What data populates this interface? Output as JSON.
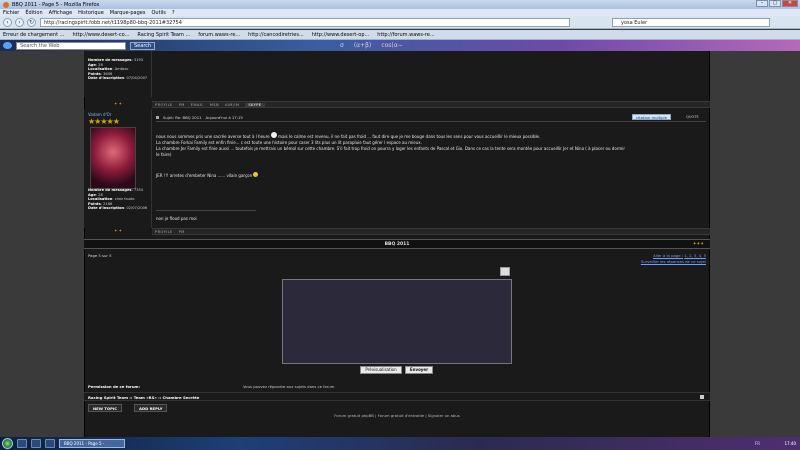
{
  "window": {
    "title": "BBQ 2011 - Page 5 - Mozilla Firefox"
  },
  "menu": [
    "Fichier",
    "Édition",
    "Affichage",
    "Historique",
    "Marque-pages",
    "Outils",
    "?"
  ],
  "urlbar": {
    "value": "http://racingspirit.fobb.net/t1198p80-bbq-2011#32754"
  },
  "browser_search": {
    "placeholder": "yosa Euler"
  },
  "bookmarks": [
    "Erreur de chargement ...",
    "http://www.desert-co...",
    "Racing Spirit Team ...",
    "forum.waws-re...",
    "http://cancodiretries...",
    "http://www.desert-op...",
    "http://forum.waws-re..."
  ],
  "addon_toolbar": {
    "search_placeholder": "Search the Web",
    "search_button": "Search"
  },
  "post1": {
    "stats": [
      [
        "Nombre de messages",
        "3193"
      ],
      [
        "Age",
        "26"
      ],
      [
        "Localisation",
        "Amtbac"
      ],
      [
        "Points",
        "3606"
      ],
      [
        "Date d'inscription",
        "07/04/2007"
      ]
    ]
  },
  "postbar1": [
    "PROFILE",
    "PM",
    "EMAIL",
    "MSN",
    "AIM/IM",
    "SKYPE"
  ],
  "post2": {
    "username": "Vadam d'Or",
    "subject": "Sujet: Re: BBQ 2011",
    "date": "Aujourd'hui à 17:15",
    "quote_multi": "citation multiple",
    "quote": "QUOTE",
    "stats": [
      [
        "Nombre de messages",
        "7354"
      ],
      [
        "Age",
        "28"
      ],
      [
        "Localisation",
        "chez foudo"
      ],
      [
        "Points",
        "2166"
      ],
      [
        "Date d'inscription",
        "02/07/2006"
      ]
    ],
    "lines": [
      "nous nous sommes pris une sacrée averse tout à l heure",
      "mais le calme est revenu, il ne fait pas froid ... faut dire que je me bouge dans tous les sens pour vous accueillir le mieux possible.",
      "La chambre Forkai Family est enfin finie... c est toute une histoire pour caser 3 lits plus un lit parapluie faut gérer l espace au mieux.",
      "La chambre Jer Family est finie aussi ... toutefois je mettrais un bémol sur cette chambre. S'il fait trop froid on pourra y loger les enfants de Pascal et Gio. Dans ce cas la tente sera montée pour accueillir Jer et Nina ( à placer ou dormir",
      "le faire)",
      "JER !!! arretes d'embeter Nina ...... vilain garçon",
      "non je flood pas moi"
    ]
  },
  "postbar2": [
    "PROFILE",
    "PM"
  ],
  "topic_bar": {
    "title": "BBQ 2011"
  },
  "pagination": {
    "left": "Page 5 sur 5",
    "right": "Aller à la page :",
    "pages": "1, 2, 3, 4, 5",
    "watch": "Surveiller les réponses de ce sujet"
  },
  "reply": {
    "preview": "Prévisualisation",
    "send": "Envoyer"
  },
  "permissions": {
    "label": "Permission de ce forum:",
    "text": "Vous pouvez répondre aux sujets dans ce forum"
  },
  "breadcrumb": "Racing Spirit Team :: Team «RS» :: Chambre Secrète",
  "newbuttons": {
    "new": "NEW TOPIC",
    "add": "ADD REPLY"
  },
  "footer": "Forum gratuit phpBB | Forum gratuit d'entraide | Signaler un abus",
  "taskbar": {
    "window": "BBQ 2011 - Page 5 -",
    "lang": "FR",
    "clock": "17:40"
  }
}
